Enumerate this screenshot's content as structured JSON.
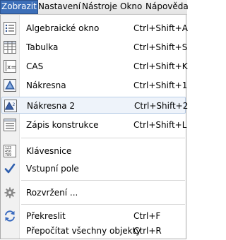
{
  "menubar": {
    "items": [
      "Zobrazit",
      "Nastavení",
      "Nástroje",
      "Okno",
      "Nápověda"
    ]
  },
  "menu": {
    "items": [
      {
        "label": "Algebraické okno",
        "shortcut": "Ctrl+Shift+A",
        "icon": "algebra-view-icon"
      },
      {
        "label": "Tabulka",
        "shortcut": "Ctrl+Shift+S",
        "icon": "spreadsheet-icon"
      },
      {
        "label": "CAS",
        "shortcut": "Ctrl+Shift+K",
        "icon": "cas-icon"
      },
      {
        "label": "Nákresna",
        "shortcut": "Ctrl+Shift+1",
        "icon": "graphics-view-icon"
      },
      {
        "label": "Nákresna 2",
        "shortcut": "Ctrl+Shift+2",
        "icon": "graphics-view-2-icon"
      },
      {
        "label": "Zápis konstrukce",
        "shortcut": "Ctrl+Shift+L",
        "icon": "construction-protocol-icon"
      },
      {
        "label": "Klávesnice",
        "shortcut": "",
        "icon": "keyboard-icon"
      },
      {
        "label": "Vstupní pole",
        "shortcut": "",
        "icon": "checkmark-icon"
      },
      {
        "label": "Rozvržení ...",
        "shortcut": "",
        "icon": "gear-icon"
      },
      {
        "label": "Překreslit",
        "shortcut": "Ctrl+F",
        "icon": "refresh-icon"
      },
      {
        "label": "Přepočítat všechny objekty",
        "shortcut": "Ctrl+R",
        "icon": ""
      }
    ]
  }
}
